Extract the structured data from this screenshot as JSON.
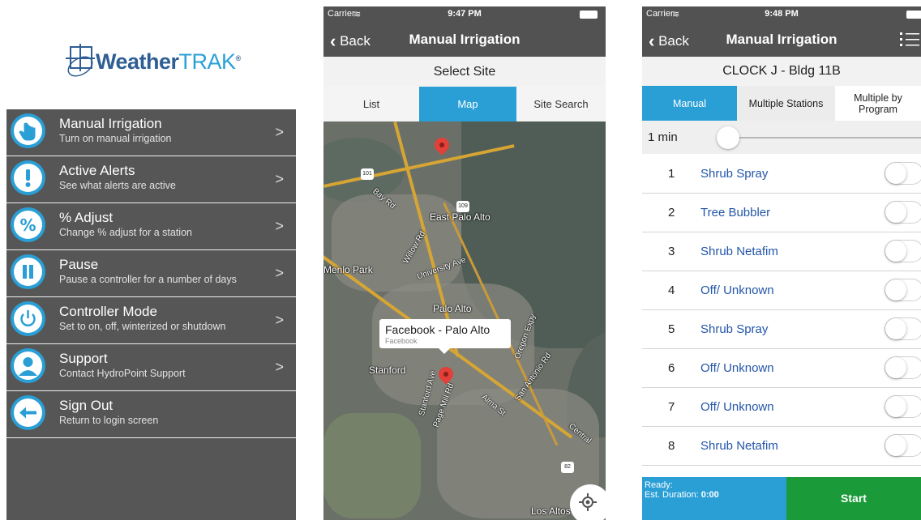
{
  "panel1": {
    "logo": {
      "weather": "Weather",
      "trak": "TRAK",
      "mark": "®"
    },
    "menu": [
      {
        "title": "Manual Irrigation",
        "subtitle": "Turn on manual irrigation",
        "icon": "hand-pointer-icon"
      },
      {
        "title": "Active Alerts",
        "subtitle": "See what alerts are active",
        "icon": "exclamation-icon"
      },
      {
        "title": "% Adjust",
        "subtitle": "Change % adjust for a station",
        "icon": "percent-icon"
      },
      {
        "title": "Pause",
        "subtitle": "Pause a controller for a number of days",
        "icon": "pause-icon"
      },
      {
        "title": "Controller Mode",
        "subtitle": "Set to on, off, winterized or shutdown",
        "icon": "power-icon"
      },
      {
        "title": "Support",
        "subtitle": "Contact HydroPoint Support",
        "icon": "person-icon"
      },
      {
        "title": "Sign Out",
        "subtitle": "Return to login screen",
        "icon": "arrow-left-icon"
      }
    ],
    "chevron": ">"
  },
  "panel2": {
    "status": {
      "carrier": "Carrier",
      "time": "9:47 PM"
    },
    "nav": {
      "back": "Back",
      "title": "Manual Irrigation"
    },
    "select_site": "Select Site",
    "segments": [
      "List",
      "Map",
      "Site Search"
    ],
    "active_segment": "Map",
    "map": {
      "labels": [
        "East Palo Alto",
        "Menlo Park",
        "Palo Alto",
        "Stanford",
        "Los Altos",
        "Bay Rd",
        "Willow Rd",
        "University Ave",
        "Alma St",
        "Central",
        "Stanford Ave",
        "Page Mill Rd",
        "San Antonio Rd",
        "Oregon Expy"
      ],
      "highways": [
        "101",
        "109",
        "82"
      ],
      "callout": {
        "title": "Facebook - Palo Alto",
        "subtitle": "Facebook"
      }
    }
  },
  "panel3": {
    "status": {
      "carrier": "Carrier",
      "time": "9:48 PM"
    },
    "nav": {
      "back": "Back",
      "title": "Manual Irrigation"
    },
    "clock": "CLOCK J - Bldg 11B",
    "tabs": [
      "Manual",
      "Multiple Stations",
      "Multiple by Program"
    ],
    "active_tab": "Manual",
    "duration_label": "1 min",
    "duration_level": 0.0,
    "stations": [
      {
        "num": "1",
        "name": "Shrub Spray"
      },
      {
        "num": "2",
        "name": "Tree Bubbler"
      },
      {
        "num": "3",
        "name": "Shrub Netafim"
      },
      {
        "num": "4",
        "name": "Off/ Unknown"
      },
      {
        "num": "5",
        "name": "Shrub Spray"
      },
      {
        "num": "6",
        "name": "Off/ Unknown"
      },
      {
        "num": "7",
        "name": "Off/ Unknown"
      },
      {
        "num": "8",
        "name": "Shrub Netafim"
      }
    ],
    "status_box": {
      "ready": "Ready:",
      "duration_label": "Est. Duration:",
      "duration_value": "0:00"
    },
    "start": "Start"
  },
  "colors": {
    "accent": "#2a9fd6",
    "start": "#1a9a38",
    "menu_bg": "#565656",
    "nav_bg": "#525252",
    "link": "#2356a8"
  }
}
